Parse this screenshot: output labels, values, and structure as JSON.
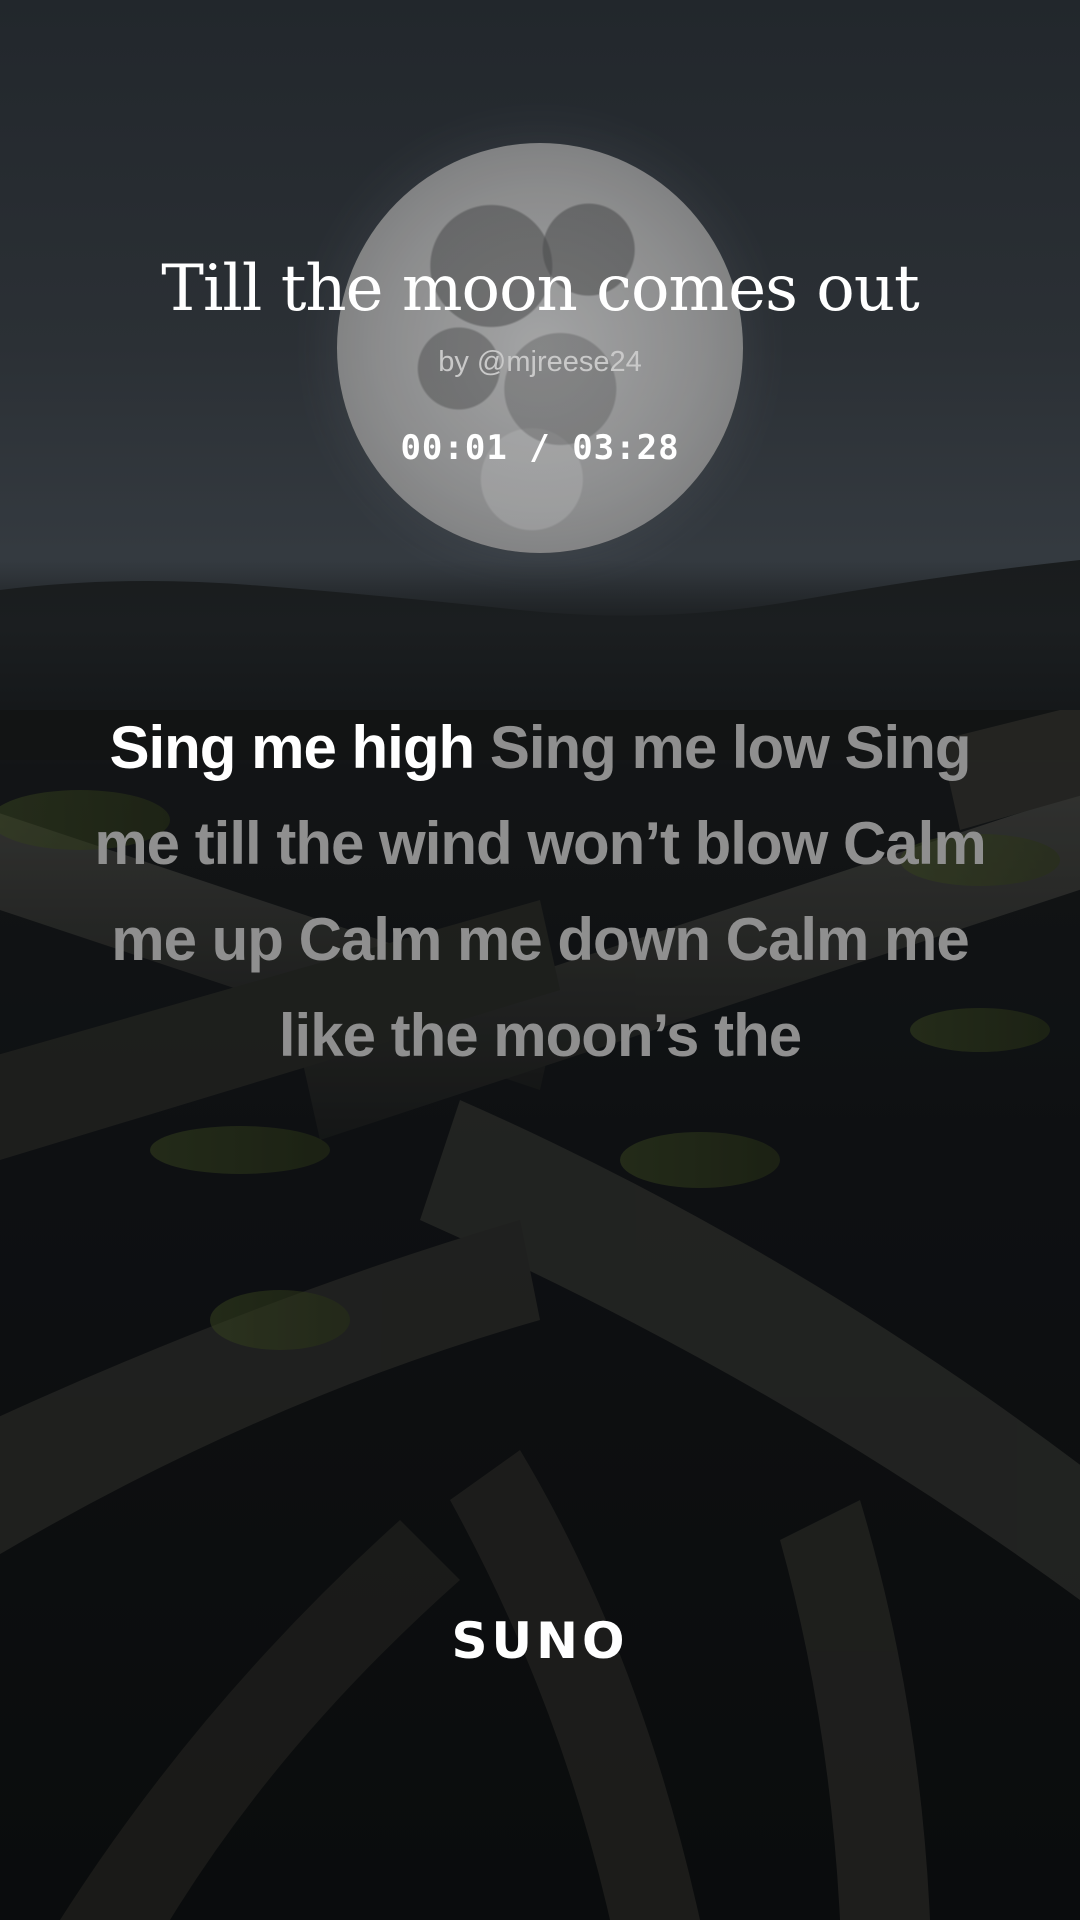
{
  "song": {
    "title": "Till the moon comes out",
    "artist": "by @mjreese24",
    "time": "00:01 / 03:28"
  },
  "lyrics": {
    "sung": "Sing me high",
    "upcoming": "Sing me low Sing me till the wind won’t blow Calm me up Calm me down Calm me like the moon’s the"
  },
  "brand": {
    "logo": "SUNO"
  },
  "colors": {
    "sung_text": "#ffffff",
    "upcoming_text": "#8f8f8f"
  }
}
